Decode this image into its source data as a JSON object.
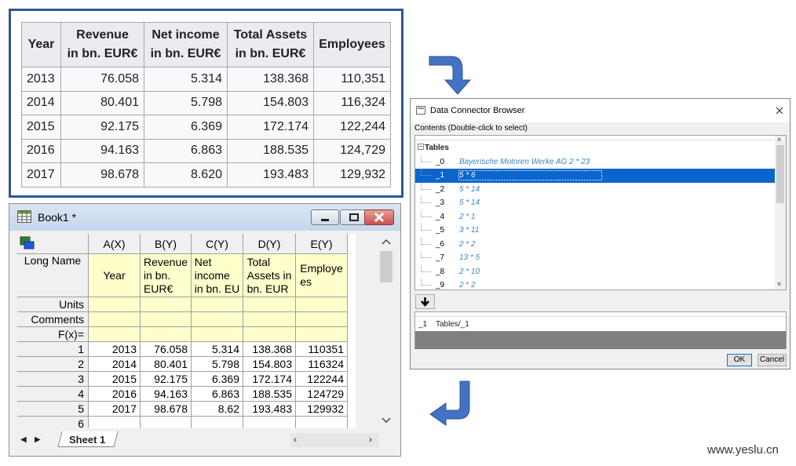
{
  "web_table": {
    "headers": [
      "Year",
      "Revenue\nin bn. EUR€",
      "Net income\nin bn. EUR€",
      "Total Assets\nin bn. EUR€",
      "Employees"
    ],
    "rows": [
      [
        "2013",
        "76.058",
        "5.314",
        "138.368",
        "110,351"
      ],
      [
        "2014",
        "80.401",
        "5.798",
        "154.803",
        "116,324"
      ],
      [
        "2015",
        "92.175",
        "6.369",
        "172.174",
        "122,244"
      ],
      [
        "2016",
        "94.163",
        "6.863",
        "188.535",
        "124,729"
      ],
      [
        "2017",
        "98.678",
        "8.620",
        "193.483",
        "129,932"
      ]
    ]
  },
  "workbook": {
    "title": "Book1 *",
    "columns": [
      "A(X)",
      "B(Y)",
      "C(Y)",
      "D(Y)",
      "E(Y)"
    ],
    "row_labels": [
      "Long Name",
      "Units",
      "Comments",
      "F(x)="
    ],
    "long_names": [
      "Year",
      "Revenue in bn. EUR€",
      "Net income in bn. EU",
      "Total Assets in bn. EUR",
      "Employees"
    ],
    "long_names_display": [
      "Year",
      "Revenue\nin bn.\nEUR€",
      "Net\nincome\nin bn. EU",
      "Total\nAssets in\nbn. EUR",
      "Employe\nes"
    ],
    "rows": [
      [
        "1",
        "2013",
        "76.058",
        "5.314",
        "138.368",
        "110351"
      ],
      [
        "2",
        "2014",
        "80.401",
        "5.798",
        "154.803",
        "116324"
      ],
      [
        "3",
        "2015",
        "92.175",
        "6.369",
        "172.174",
        "122244"
      ],
      [
        "4",
        "2016",
        "94.163",
        "6.863",
        "188.535",
        "124729"
      ],
      [
        "5",
        "2017",
        "98.678",
        "8.62",
        "193.483",
        "129932"
      ],
      [
        "6",
        "",
        "",
        "",
        "",
        ""
      ]
    ],
    "sheet_tab": "Sheet 1"
  },
  "dialog": {
    "title": "Data Connector Browser",
    "contents_label": "Contents (Double-click to select)",
    "root": "Tables",
    "items": [
      {
        "name": "_0",
        "value": "Bayerische Motoren Werke AG 2 * 23"
      },
      {
        "name": "_1",
        "value": "5 * 6",
        "selected": true
      },
      {
        "name": "_2",
        "value": "5 * 14"
      },
      {
        "name": "_3",
        "value": "5 * 14"
      },
      {
        "name": "_4",
        "value": "2 * 1"
      },
      {
        "name": "_5",
        "value": "3 * 11"
      },
      {
        "name": "_6",
        "value": "2 * 2"
      },
      {
        "name": "_7",
        "value": "13 * 5"
      },
      {
        "name": "_8",
        "value": "2 * 10"
      },
      {
        "name": "_9",
        "value": "2 * 2"
      }
    ],
    "selected_name": "_1",
    "selected_path": "Tables/_1",
    "ok_label": "OK",
    "cancel_label": "Cancel"
  },
  "colors": {
    "arrow": "#4472c4",
    "frame": "#2f5597",
    "selection": "#0a66cc",
    "yellow": "#ffffcc"
  },
  "watermark": "www.yeslu.cn"
}
